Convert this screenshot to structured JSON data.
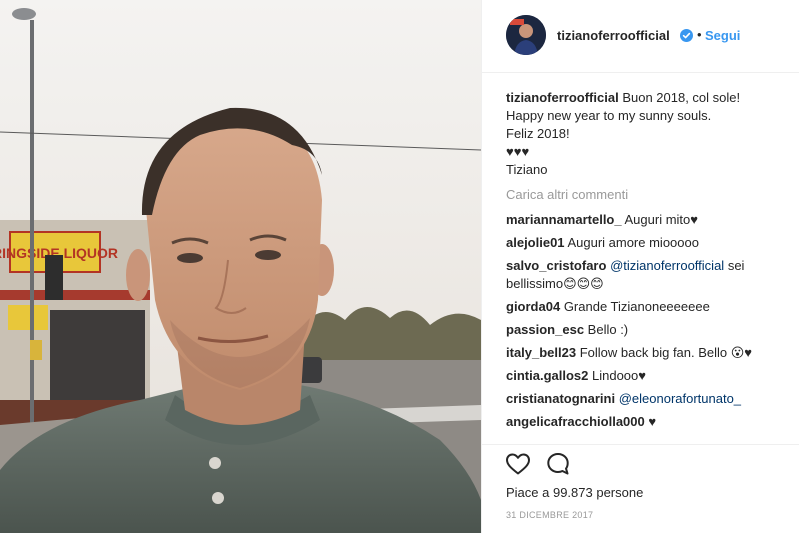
{
  "post": {
    "username": "tizianoferroofficial",
    "follow_separator": "•",
    "follow_label": "Segui",
    "caption_lines": [
      "Buon 2018, col sole!",
      "Happy new year to my sunny souls.",
      "Feliz 2018!",
      "♥♥♥",
      "Tiziano"
    ],
    "load_more": "Carica altri commenti",
    "likes_text": "Piace a 99.873 persone",
    "date": "31 DICEMBRE 2017"
  },
  "comments": [
    {
      "user": "mariannamartello_",
      "text": "Auguri mito♥"
    },
    {
      "user": "alejolie01",
      "text": "Auguri amore miooooo"
    },
    {
      "user": "salvo_cristofaro",
      "mention": "@tizianoferroofficial",
      "text": "sei bellissimo😊😊😊"
    },
    {
      "user": "giorda04",
      "text": "Grande Tizianoneeeeeee"
    },
    {
      "user": "passion_esc",
      "text": "Bello :)"
    },
    {
      "user": "italy_bell23",
      "text": "Follow back big fan. Bello 😮♥"
    },
    {
      "user": "cintia.gallos2",
      "text": "Lindooo♥"
    },
    {
      "user": "cristianatognarini",
      "mention": "@eleonorafortunato_",
      "text": ""
    },
    {
      "user": "angelicafracchiolla000",
      "text": "♥"
    }
  ],
  "photo": {
    "store_sign": "RINGSIDE LIQUOR"
  },
  "icons": {
    "verified": "verified-badge-icon",
    "like": "heart-icon",
    "comment": "comment-bubble-icon"
  },
  "colors": {
    "link_blue": "#3897f0",
    "mention_blue": "#003569",
    "muted": "#999999",
    "text": "#262626"
  }
}
